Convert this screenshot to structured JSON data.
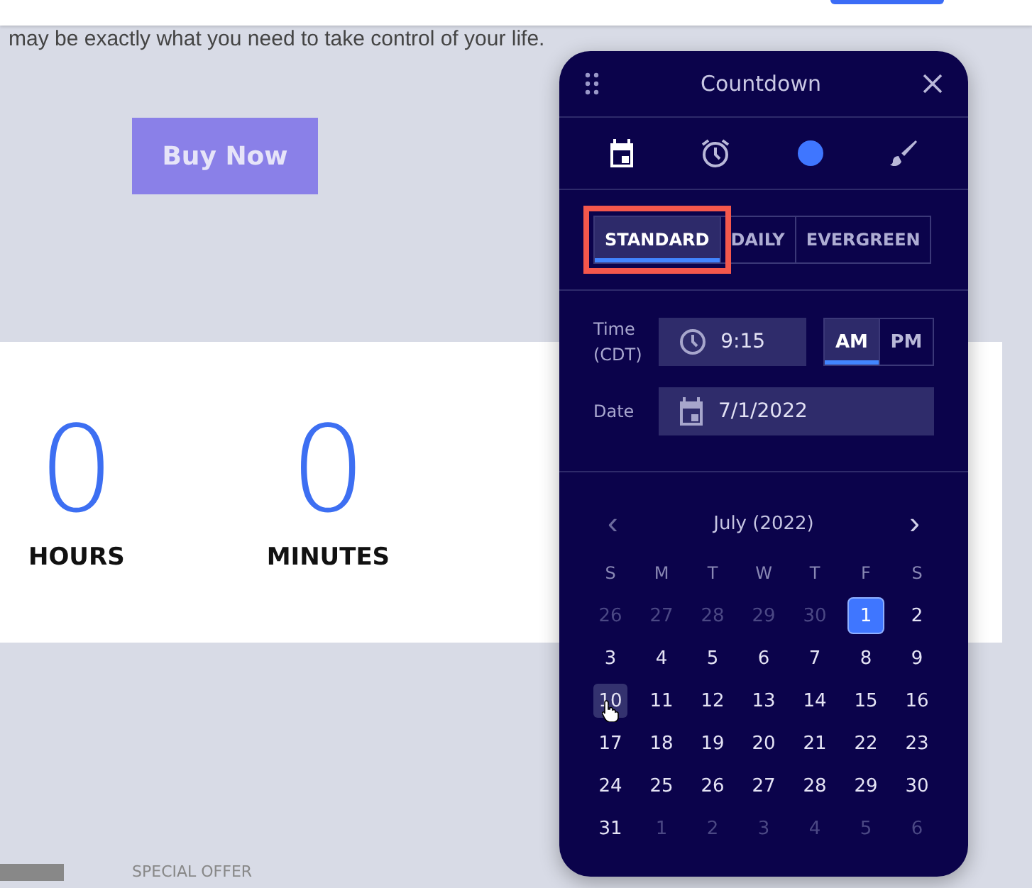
{
  "page": {
    "intro_text": "may be exactly what you need to take control of your life.",
    "buy_button": "Buy Now",
    "countdown": [
      {
        "value": "0",
        "unit": "HOURS"
      },
      {
        "value": "0",
        "unit": "MINUTES"
      }
    ],
    "section_label": "SPECIAL OFFER"
  },
  "panel": {
    "title": "Countdown",
    "tool_tabs": [
      {
        "kind": "calendar",
        "selected": true
      },
      {
        "kind": "alarm",
        "selected": false
      },
      {
        "kind": "color",
        "selected": false
      },
      {
        "kind": "brush",
        "selected": false
      }
    ],
    "modes": [
      {
        "label": "STANDARD",
        "selected": true,
        "highlighted": true
      },
      {
        "label": "DAILY",
        "selected": false,
        "highlighted": false
      },
      {
        "label": "EVERGREEN",
        "selected": false,
        "highlighted": false
      }
    ],
    "time": {
      "label": "Time\n(CDT)",
      "value": "9:15"
    },
    "meridiem": [
      {
        "label": "AM",
        "selected": true
      },
      {
        "label": "PM",
        "selected": false
      }
    ],
    "date": {
      "label": "Date",
      "value": "7/1/2022"
    },
    "calendar": {
      "month": "July (2022)",
      "prev": "‹",
      "next": "›",
      "weekdays": [
        "S",
        "M",
        "T",
        "W",
        "T",
        "F",
        "S"
      ],
      "weeks": [
        [
          {
            "label": "26",
            "muted": true,
            "selected": false,
            "hovered": false
          },
          {
            "label": "27",
            "muted": true,
            "selected": false,
            "hovered": false
          },
          {
            "label": "28",
            "muted": true,
            "selected": false,
            "hovered": false
          },
          {
            "label": "29",
            "muted": true,
            "selected": false,
            "hovered": false
          },
          {
            "label": "30",
            "muted": true,
            "selected": false,
            "hovered": false
          },
          {
            "label": "1",
            "muted": false,
            "selected": true,
            "hovered": false
          },
          {
            "label": "2",
            "muted": false,
            "selected": false,
            "hovered": false
          }
        ],
        [
          {
            "label": "3",
            "muted": false,
            "selected": false,
            "hovered": false
          },
          {
            "label": "4",
            "muted": false,
            "selected": false,
            "hovered": false
          },
          {
            "label": "5",
            "muted": false,
            "selected": false,
            "hovered": false
          },
          {
            "label": "6",
            "muted": false,
            "selected": false,
            "hovered": false
          },
          {
            "label": "7",
            "muted": false,
            "selected": false,
            "hovered": false
          },
          {
            "label": "8",
            "muted": false,
            "selected": false,
            "hovered": false
          },
          {
            "label": "9",
            "muted": false,
            "selected": false,
            "hovered": false
          }
        ],
        [
          {
            "label": "10",
            "muted": false,
            "selected": false,
            "hovered": true
          },
          {
            "label": "11",
            "muted": false,
            "selected": false,
            "hovered": false
          },
          {
            "label": "12",
            "muted": false,
            "selected": false,
            "hovered": false
          },
          {
            "label": "13",
            "muted": false,
            "selected": false,
            "hovered": false
          },
          {
            "label": "14",
            "muted": false,
            "selected": false,
            "hovered": false
          },
          {
            "label": "15",
            "muted": false,
            "selected": false,
            "hovered": false
          },
          {
            "label": "16",
            "muted": false,
            "selected": false,
            "hovered": false
          }
        ],
        [
          {
            "label": "17",
            "muted": false,
            "selected": false,
            "hovered": false
          },
          {
            "label": "18",
            "muted": false,
            "selected": false,
            "hovered": false
          },
          {
            "label": "19",
            "muted": false,
            "selected": false,
            "hovered": false
          },
          {
            "label": "20",
            "muted": false,
            "selected": false,
            "hovered": false
          },
          {
            "label": "21",
            "muted": false,
            "selected": false,
            "hovered": false
          },
          {
            "label": "22",
            "muted": false,
            "selected": false,
            "hovered": false
          },
          {
            "label": "23",
            "muted": false,
            "selected": false,
            "hovered": false
          }
        ],
        [
          {
            "label": "24",
            "muted": false,
            "selected": false,
            "hovered": false
          },
          {
            "label": "25",
            "muted": false,
            "selected": false,
            "hovered": false
          },
          {
            "label": "26",
            "muted": false,
            "selected": false,
            "hovered": false
          },
          {
            "label": "27",
            "muted": false,
            "selected": false,
            "hovered": false
          },
          {
            "label": "28",
            "muted": false,
            "selected": false,
            "hovered": false
          },
          {
            "label": "29",
            "muted": false,
            "selected": false,
            "hovered": false
          },
          {
            "label": "30",
            "muted": false,
            "selected": false,
            "hovered": false
          }
        ],
        [
          {
            "label": "31",
            "muted": false,
            "selected": false,
            "hovered": false
          },
          {
            "label": "1",
            "muted": true,
            "selected": false,
            "hovered": false
          },
          {
            "label": "2",
            "muted": true,
            "selected": false,
            "hovered": false
          },
          {
            "label": "3",
            "muted": true,
            "selected": false,
            "hovered": false
          },
          {
            "label": "4",
            "muted": true,
            "selected": false,
            "hovered": false
          },
          {
            "label": "5",
            "muted": true,
            "selected": false,
            "hovered": false
          },
          {
            "label": "6",
            "muted": true,
            "selected": false,
            "hovered": false
          }
        ]
      ]
    }
  }
}
